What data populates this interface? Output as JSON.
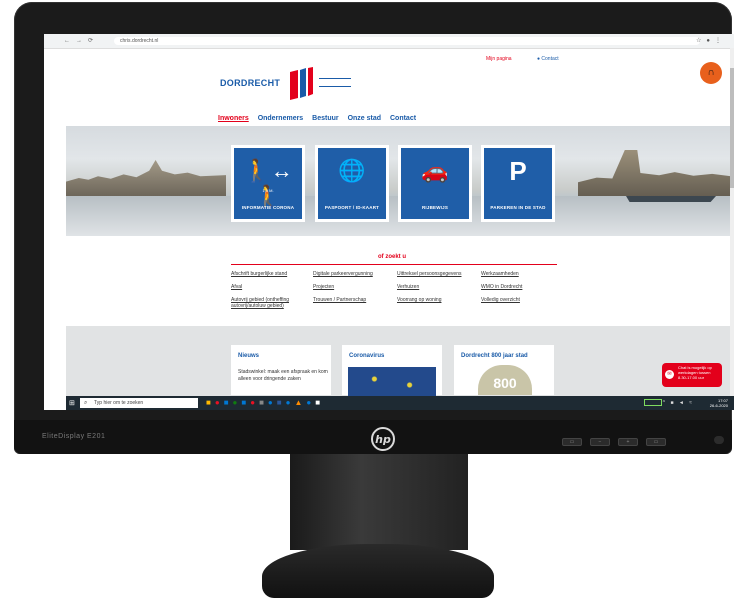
{
  "monitor": {
    "model": "EliteDisplay E201",
    "logo": "hp"
  },
  "browser": {
    "url": "chris.dordrecht.nl"
  },
  "site": {
    "top_links": {
      "my_page": "Mijn pagina",
      "contact": "Contact"
    },
    "logo_text": "DORDRECHT",
    "nav": [
      "Inwoners",
      "Ondernemers",
      "Bestuur",
      "Onze stad",
      "Contact"
    ],
    "tiles": [
      {
        "label": "INFORMATIE CORONA",
        "icon": "distance-1-5m-icon",
        "note": "1,5 M."
      },
      {
        "label": "PASPOORT / ID-KAART",
        "icon": "passport-icon"
      },
      {
        "label": "RIJBEWIJS",
        "icon": "car-icon"
      },
      {
        "label": "PARKEREN IN DE STAD",
        "icon": "parking-icon"
      }
    ],
    "or_search_title": "of zoekt u",
    "links": [
      [
        "Afschrift burgerlijke stand",
        "Afval",
        "Autovrij gebied (ontheffing autovrij/autoluw gebied)"
      ],
      [
        "Digitale parkeervergunning",
        "Projecten",
        "Trouwen / Partnerschap"
      ],
      [
        "Uittreksel persoonsgegevens",
        "Verhuizen",
        "Voorrang op woning"
      ],
      [
        "Werkzaamheden",
        "WMO in Dordrecht",
        "Volledig overzicht"
      ]
    ],
    "cards": [
      {
        "title": "Nieuws",
        "body": "Stadswinkel: maak een afspraak en kom alleen voor dringende zaken"
      },
      {
        "title": "Coronavirus",
        "body": ""
      },
      {
        "title": "Dordrecht 800 jaar stad",
        "body": "800"
      }
    ],
    "chat": {
      "text": "Chat is mogelijk op werkdagen tussen 8.30-17.00 uur"
    }
  },
  "taskbar": {
    "search_placeholder": "Typ hier om te zoeken",
    "time": "17:07",
    "date": "26-6-2020"
  },
  "colors": {
    "brand_blue": "#1a5ba8",
    "brand_red": "#e3001b",
    "orange": "#e8601c"
  }
}
